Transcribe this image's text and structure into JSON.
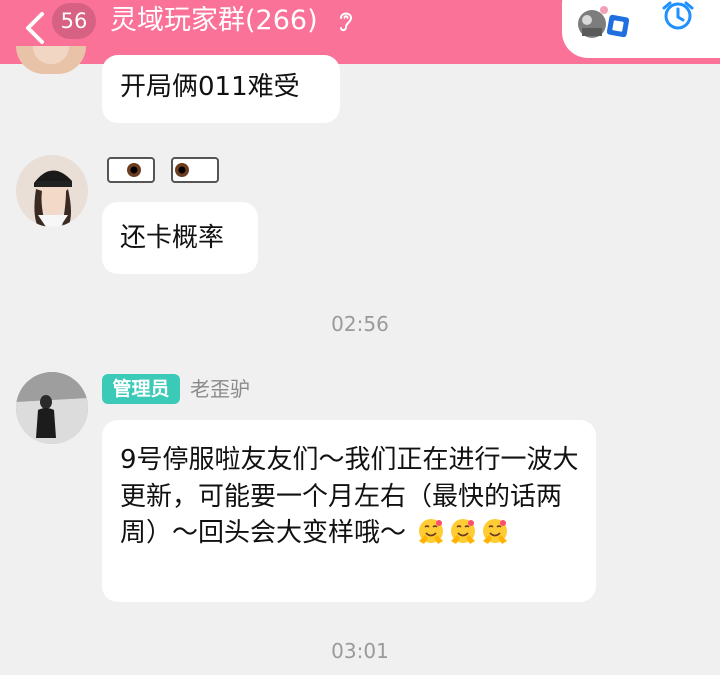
{
  "header": {
    "unread_badge": "56",
    "title": "灵域玩家群(266)"
  },
  "messages": [
    {
      "text": "开局俩011难受"
    },
    {
      "text": "还卡概率"
    },
    {
      "text_prefix": "9号停服啦友友们～我们正在进行一波大更新，可能要一个月左右（最快的话两周）～回头会大变样哦～"
    }
  ],
  "timestamps": [
    "02:56",
    "03:01"
  ],
  "admin_message": {
    "role_tag": "管理员",
    "sender": "老歪驴"
  },
  "colors": {
    "header": "#fb7299",
    "admin_tag": "#3bc9b8",
    "alarm": "#1e90ff",
    "background": "#f0f0f0"
  }
}
